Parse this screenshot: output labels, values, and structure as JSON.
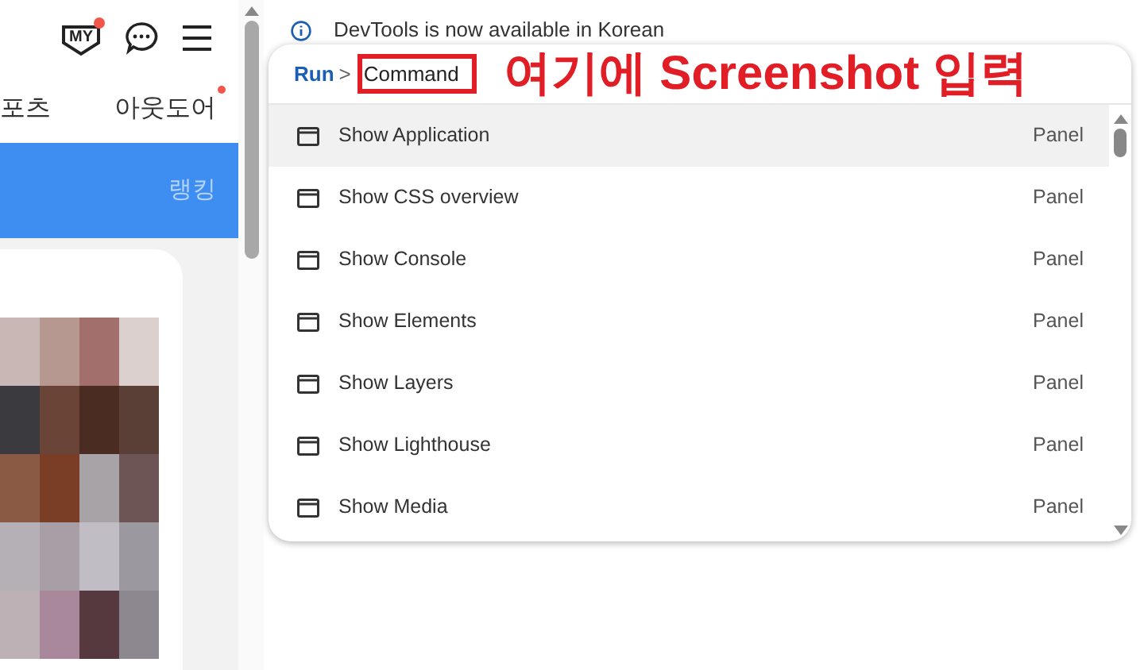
{
  "site": {
    "header": {
      "my_label": "MY",
      "my_notification": true
    },
    "tabs": [
      {
        "label": "포츠",
        "new": false
      },
      {
        "label": "아웃도어",
        "new": true
      }
    ],
    "banner": {
      "label": "랭킹"
    }
  },
  "devtools": {
    "notice": "DevTools is now available in Korean",
    "palette": {
      "prefix": "Run",
      "prompt": ">",
      "query": "Command",
      "items": [
        {
          "label": "Show Application",
          "category": "Panel",
          "selected": true
        },
        {
          "label": "Show CSS overview",
          "category": "Panel",
          "selected": false
        },
        {
          "label": "Show Console",
          "category": "Panel",
          "selected": false
        },
        {
          "label": "Show Elements",
          "category": "Panel",
          "selected": false
        },
        {
          "label": "Show Layers",
          "category": "Panel",
          "selected": false
        },
        {
          "label": "Show Lighthouse",
          "category": "Panel",
          "selected": false
        },
        {
          "label": "Show Media",
          "category": "Panel",
          "selected": false
        }
      ]
    }
  },
  "annotation": {
    "text": "여기에 Screenshot 입력"
  }
}
